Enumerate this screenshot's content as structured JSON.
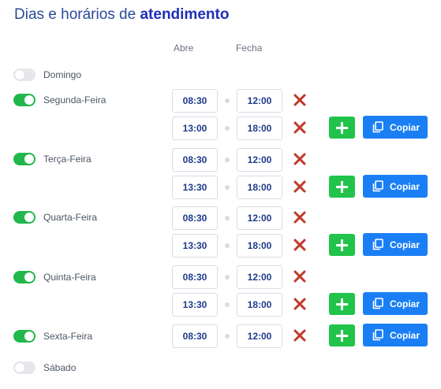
{
  "title": {
    "prefix": "Dias e horários de",
    "emphasis": "atendimento"
  },
  "columns": {
    "open": "Abre",
    "close": "Fecha"
  },
  "colors": {
    "toggle_on": "#22b74b",
    "toggle_off": "#e5e7eb",
    "add_button": "#22c34a",
    "copy_button": "#1a7ff5",
    "remove_icon": "#c0392b",
    "time_text": "#1e3a8a"
  },
  "actions": {
    "copy_label": "Copiar",
    "add_icon": "plus-icon",
    "copy_icon": "copy-icon",
    "remove_icon": "close-icon"
  },
  "days": [
    {
      "name": "Domingo",
      "enabled": false,
      "slots": []
    },
    {
      "name": "Segunda-Feira",
      "enabled": true,
      "slots": [
        {
          "open": "08:30",
          "close": "12:00"
        },
        {
          "open": "13:00",
          "close": "18:00"
        }
      ]
    },
    {
      "name": "Terça-Feira",
      "enabled": true,
      "slots": [
        {
          "open": "08:30",
          "close": "12:00"
        },
        {
          "open": "13:30",
          "close": "18:00"
        }
      ]
    },
    {
      "name": "Quarta-Feira",
      "enabled": true,
      "slots": [
        {
          "open": "08:30",
          "close": "12:00"
        },
        {
          "open": "13:30",
          "close": "18:00"
        }
      ]
    },
    {
      "name": "Quinta-Feira",
      "enabled": true,
      "slots": [
        {
          "open": "08:30",
          "close": "12:00"
        },
        {
          "open": "13:30",
          "close": "18:00"
        }
      ]
    },
    {
      "name": "Sexta-Feira",
      "enabled": true,
      "slots": [
        {
          "open": "08:30",
          "close": "12:00"
        }
      ]
    },
    {
      "name": "Sábado",
      "enabled": false,
      "slots": []
    }
  ]
}
